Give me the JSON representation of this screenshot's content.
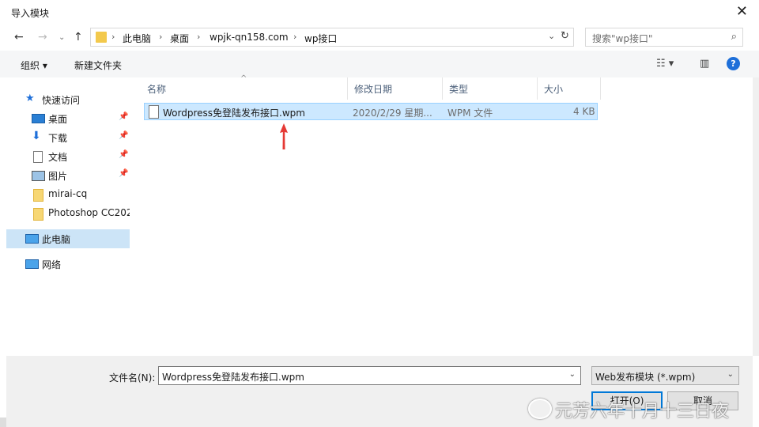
{
  "window": {
    "title": "导入模块"
  },
  "address": {
    "crumbs": [
      "此电脑",
      "桌面",
      "wpjk-qn158.com",
      "wp接口"
    ],
    "search_placeholder": "搜索\"wp接口\""
  },
  "toolbar": {
    "organize": "组织 ▾",
    "new_folder": "新建文件夹"
  },
  "sidebar": {
    "items": [
      {
        "label": "快速访问",
        "icon": "star-icon"
      },
      {
        "label": "桌面",
        "icon": "desktop-icon",
        "pinned": true
      },
      {
        "label": "下载",
        "icon": "download-icon",
        "pinned": true
      },
      {
        "label": "文档",
        "icon": "document-icon",
        "pinned": true
      },
      {
        "label": "图片",
        "icon": "picture-icon",
        "pinned": true
      },
      {
        "label": "mirai-cq",
        "icon": "folder-icon"
      },
      {
        "label": "Photoshop CC202",
        "icon": "folder-icon"
      },
      {
        "label": "此电脑",
        "icon": "computer-icon",
        "selected": true
      },
      {
        "label": "网络",
        "icon": "network-icon"
      }
    ]
  },
  "columns": [
    "名称",
    "修改日期",
    "类型",
    "大小"
  ],
  "files": [
    {
      "name": "Wordpress免登陆发布接口.wpm",
      "date": "2020/2/29 星期...",
      "type": "WPM 文件",
      "size": "4 KB"
    }
  ],
  "footer": {
    "filename_label": "文件名(N):",
    "filename_value": "Wordpress免登陆发布接口.wpm",
    "filter_value": "Web发布模块 (*.wpm)",
    "open_label": "打开(O)",
    "cancel_label": "取消"
  },
  "watermark": "元芳六年十月十三日夜",
  "colors": {
    "accent": "#0078d7",
    "selection": "#cce8ff",
    "arrow": "#e53935"
  }
}
